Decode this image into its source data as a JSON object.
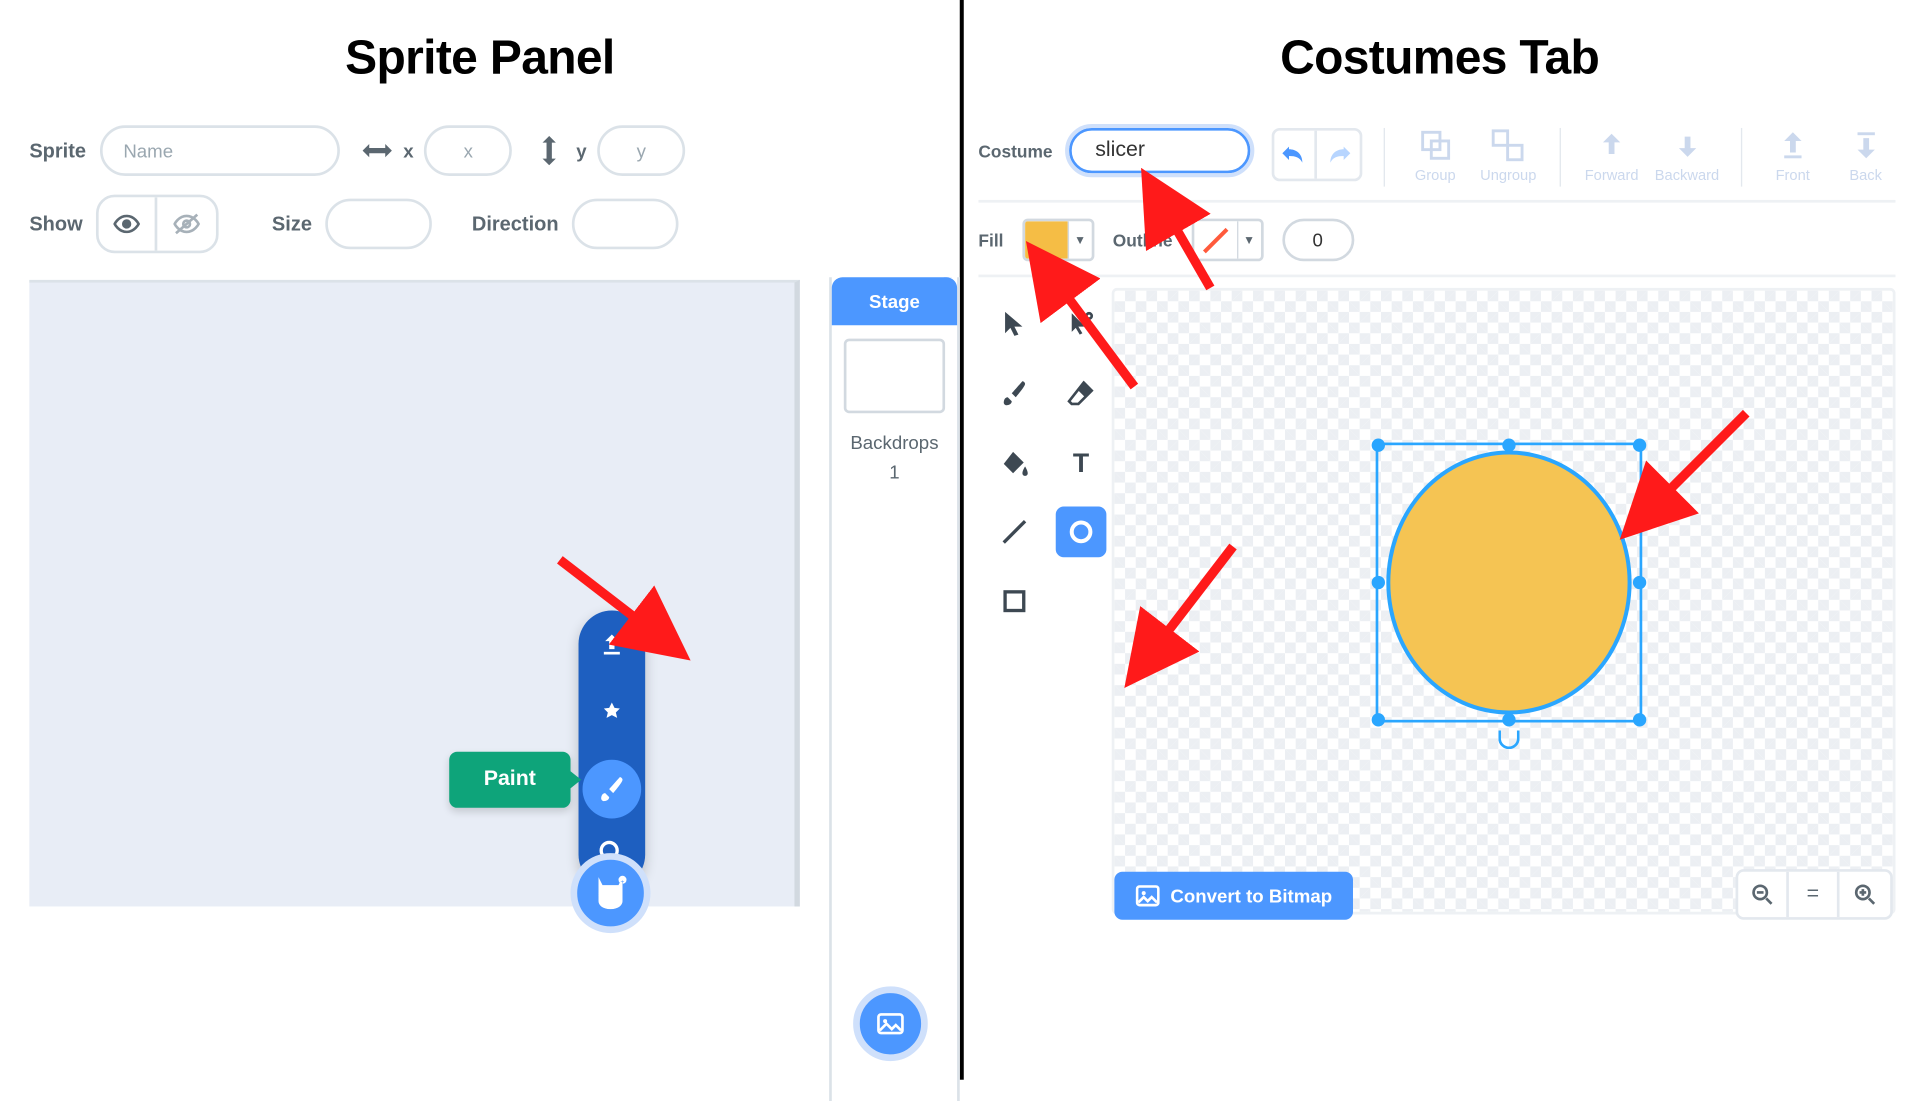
{
  "left": {
    "title": "Sprite Panel",
    "spriteLabel": "Sprite",
    "namePlaceholder": "Name",
    "xLabel": "x",
    "xVal": "x",
    "yLabel": "y",
    "yVal": "y",
    "showLabel": "Show",
    "sizeLabel": "Size",
    "directionLabel": "Direction",
    "stageLabel": "Stage",
    "backdropsLabel": "Backdrops",
    "backdropsCount": "1",
    "paintTooltip": "Paint"
  },
  "right": {
    "title": "Costumes Tab",
    "costumeLabel": "Costume",
    "costumeName": "slicer",
    "groupLabel": "Group",
    "ungroupLabel": "Ungroup",
    "forwardLabel": "Forward",
    "backwardLabel": "Backward",
    "frontLabel": "Front",
    "backLabel": "Back",
    "fillLabel": "Fill",
    "outlineLabel": "Outline",
    "outlineWidth": "0",
    "convertLabel": "Convert to Bitmap",
    "fillColor": "#f5bd45"
  }
}
